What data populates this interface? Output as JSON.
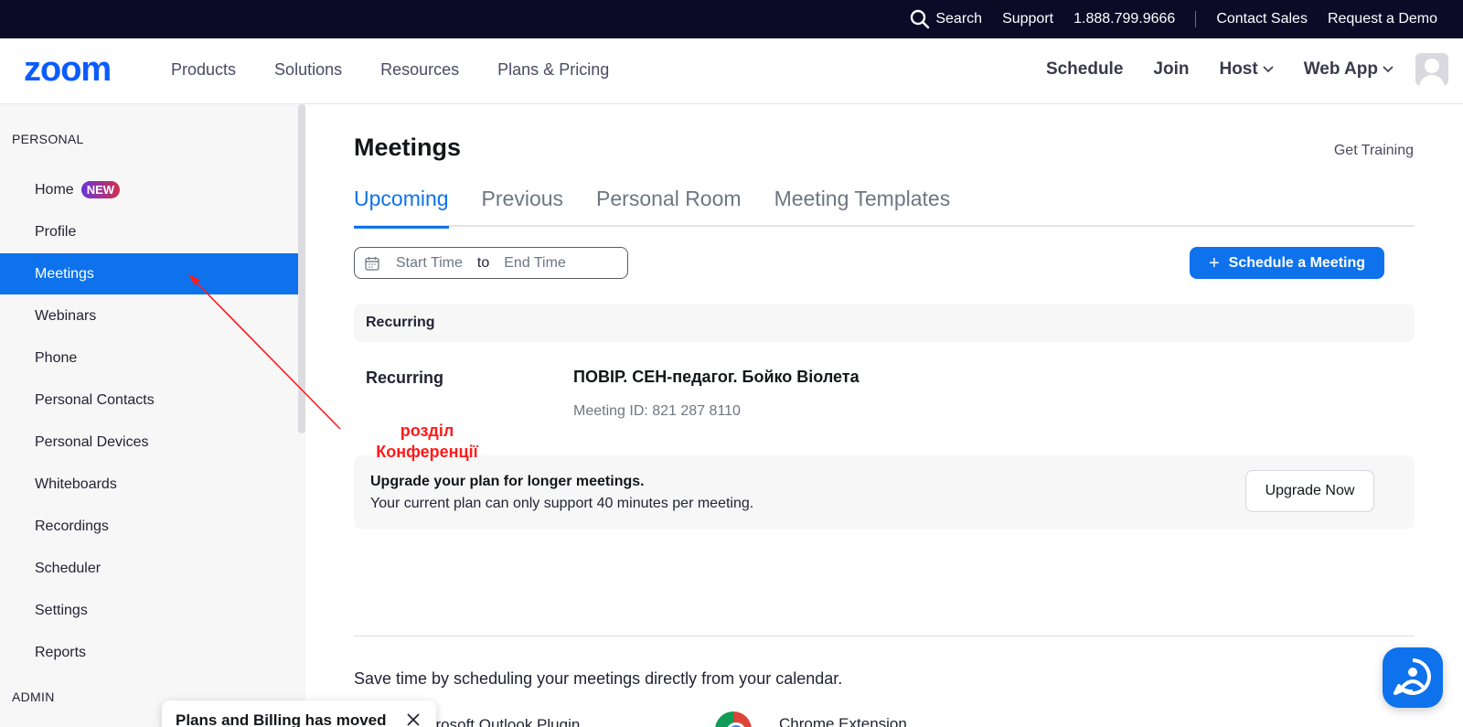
{
  "topbar": {
    "search": "Search",
    "support": "Support",
    "phone": "1.888.799.9666",
    "contact_sales": "Contact Sales",
    "request_demo": "Request a Demo"
  },
  "nav": {
    "logo": "zoom",
    "menu": [
      "Products",
      "Solutions",
      "Resources",
      "Plans & Pricing"
    ],
    "schedule": "Schedule",
    "join": "Join",
    "host": "Host",
    "web_app": "Web App"
  },
  "sidebar": {
    "section_personal": "PERSONAL",
    "section_admin": "ADMIN",
    "new_badge": "NEW",
    "items": [
      {
        "label": "Home"
      },
      {
        "label": "Profile"
      },
      {
        "label": "Meetings"
      },
      {
        "label": "Webinars"
      },
      {
        "label": "Phone"
      },
      {
        "label": "Personal Contacts"
      },
      {
        "label": "Personal Devices"
      },
      {
        "label": "Whiteboards"
      },
      {
        "label": "Recordings"
      },
      {
        "label": "Scheduler"
      },
      {
        "label": "Settings"
      },
      {
        "label": "Reports"
      }
    ],
    "active_item": "Meetings"
  },
  "main": {
    "title": "Meetings",
    "get_training": "Get Training",
    "tabs": [
      {
        "label": "Upcoming"
      },
      {
        "label": "Previous"
      },
      {
        "label": "Personal Room"
      },
      {
        "label": "Meeting Templates"
      }
    ],
    "active_tab": "Upcoming",
    "date_range": {
      "start": "Start Time",
      "to": "to",
      "end": "End Time"
    },
    "schedule_button": "Schedule a Meeting",
    "recurring_header": "Recurring",
    "meeting": {
      "type": "Recurring",
      "title": "ПОВІР. СЕН-педагог. Бойко Віолета",
      "id_label": "Meeting ID: 821 287 8110"
    },
    "upgrade": {
      "title": "Upgrade your plan for longer meetings.",
      "text": "Your current plan can only support 40 minutes per meeting.",
      "button": "Upgrade Now"
    },
    "calendar_text": "Save time by scheduling your meetings directly from your calendar.",
    "plugin_outlook": "crosoft Outlook Plugin",
    "plugin_chrome": "Chrome Extension"
  },
  "toast": {
    "text": "Plans and Billing has moved"
  },
  "annotation": {
    "line1": "розділ",
    "line2": "Конференції",
    "color": "#ff1a1a"
  },
  "colors": {
    "accent": "#0e72ed",
    "topbar": "#0b0b28"
  }
}
